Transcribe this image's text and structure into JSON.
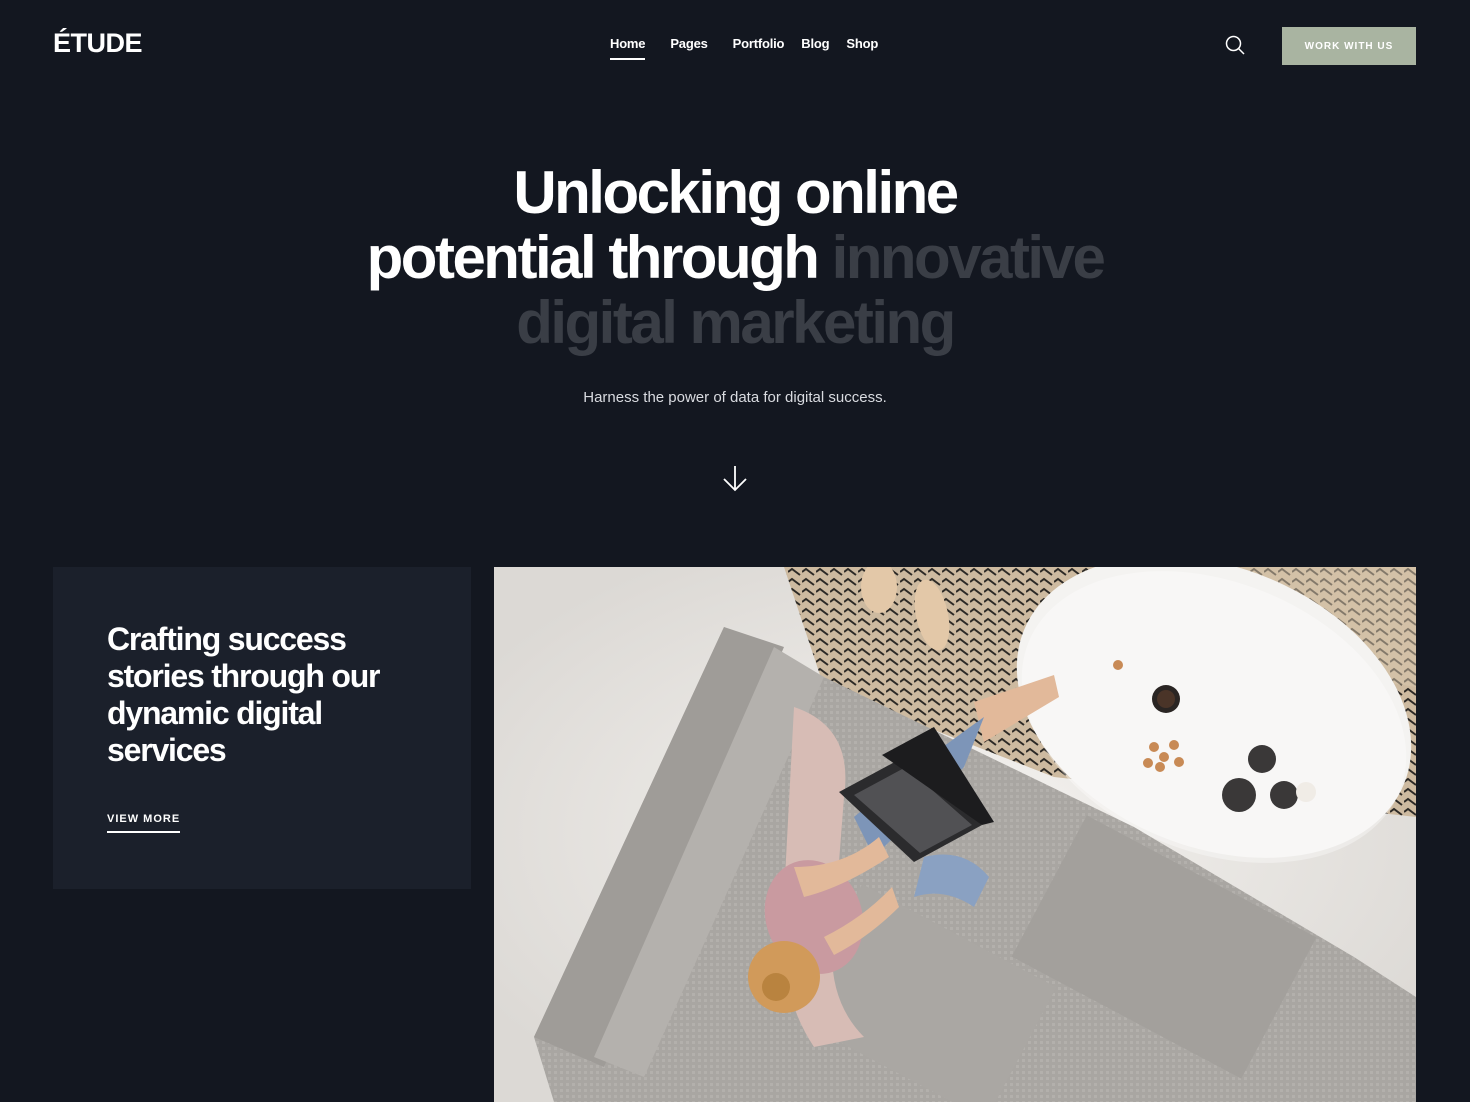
{
  "brand": {
    "logo_text": "ÉTUDE"
  },
  "nav": {
    "items": [
      {
        "label": "Home",
        "active": true
      },
      {
        "label": "Pages",
        "active": false
      },
      {
        "label": "Portfolio",
        "active": false
      },
      {
        "label": "Blog",
        "active": false
      },
      {
        "label": "Shop",
        "active": false
      }
    ]
  },
  "header": {
    "search_icon": "search-icon",
    "cta_label": "WORK WITH US",
    "cta_color": "#a9b4a1"
  },
  "hero": {
    "title_line1": "Unlocking online",
    "title_line2_bright": "potential through",
    "title_line2_dim": "innovative",
    "title_line3_dim": "digital marketing",
    "subtitle": "Harness the power of data for digital success.",
    "scroll_icon": "arrow-down-icon"
  },
  "feature_card": {
    "title": "Crafting success stories through our dynamic digital services",
    "link_label": "VIEW MORE"
  },
  "colors": {
    "background": "#131720",
    "card_background": "#1b202b",
    "dim_text": "#3a3e46"
  }
}
